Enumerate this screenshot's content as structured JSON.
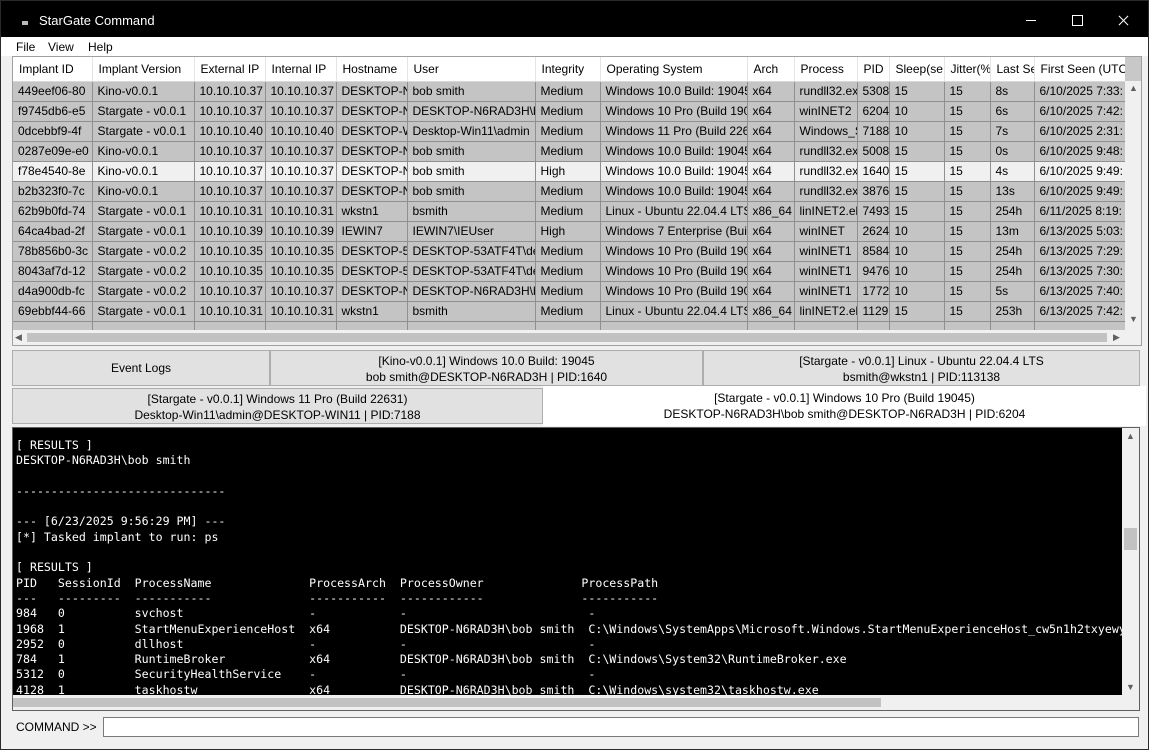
{
  "window": {
    "title": "StarGate Command"
  },
  "menu": [
    "File",
    "View",
    "Help"
  ],
  "grid": {
    "columns": [
      "Implant ID",
      "Implant Version",
      "External IP",
      "Internal IP",
      "Hostname",
      "User",
      "Integrity",
      "Operating System",
      "Arch",
      "Process",
      "PID",
      "Sleep(se",
      "Jitter(%",
      "Last Se",
      "First Seen (UTC)"
    ],
    "rows": [
      [
        "449eef06-80",
        "Kino-v0.0.1",
        "10.10.10.37",
        "10.10.10.37",
        "DESKTOP-N",
        "bob smith",
        "Medium",
        "Windows 10.0 Build: 19045",
        "x64",
        "rundll32.ex",
        "5308",
        "15",
        "15",
        "8s",
        "6/10/2025 7:33:"
      ],
      [
        "f9745db6-e5",
        "Stargate - v0.0.1",
        "10.10.10.37",
        "10.10.10.37",
        "DESKTOP-N",
        "DESKTOP-N6RAD3H\\bob",
        "Medium",
        "Windows 10 Pro (Build 190",
        "x64",
        "winINET2",
        "6204",
        "10",
        "15",
        "6s",
        "6/10/2025 7:42:"
      ],
      [
        "0dcebbf9-4f",
        "Stargate - v0.0.1",
        "10.10.10.40",
        "10.10.10.40",
        "DESKTOP-W",
        "Desktop-Win11\\admin",
        "Medium",
        "Windows 11 Pro (Build 226",
        "x64",
        "Windows_S",
        "7188",
        "10",
        "15",
        "7s",
        "6/10/2025 2:31:"
      ],
      [
        "0287e09e-e0",
        "Kino-v0.0.1",
        "10.10.10.37",
        "10.10.10.37",
        "DESKTOP-N",
        "bob smith",
        "Medium",
        "Windows 10.0 Build: 19045",
        "x64",
        "rundll32.ex",
        "5008",
        "15",
        "15",
        "0s",
        "6/10/2025 9:48:"
      ],
      [
        "f78e4540-8e",
        "Kino-v0.0.1",
        "10.10.10.37",
        "10.10.10.37",
        "DESKTOP-N",
        "bob smith",
        "High",
        "Windows 10.0 Build: 19045",
        "x64",
        "rundll32.ex",
        "1640",
        "15",
        "15",
        "4s",
        "6/10/2025 9:49:"
      ],
      [
        "b2b323f0-7c",
        "Kino-v0.0.1",
        "10.10.10.37",
        "10.10.10.37",
        "DESKTOP-N",
        "bob smith",
        "Medium",
        "Windows 10.0 Build: 19045",
        "x64",
        "rundll32.ex",
        "3876",
        "15",
        "15",
        "13s",
        "6/10/2025 9:49:"
      ],
      [
        "62b9b0fd-74",
        "Stargate - v0.0.1",
        "10.10.10.31",
        "10.10.10.31",
        "wkstn1",
        "bsmith",
        "Medium",
        "Linux - Ubuntu 22.04.4 LTS",
        "x86_64",
        "linINET2.elf",
        "7493",
        "15",
        "15",
        "254h",
        "6/11/2025 8:19:"
      ],
      [
        "64ca4bad-2f",
        "Stargate - v0.0.1",
        "10.10.10.39",
        "10.10.10.39",
        "IEWIN7",
        "IEWIN7\\IEUser",
        "High",
        "Windows 7 Enterprise (Bui",
        "x64",
        "winINET",
        "2624",
        "10",
        "15",
        "13m",
        "6/13/2025 5:03:"
      ],
      [
        "78b856b0-3c",
        "Stargate - v0.0.2",
        "10.10.10.35",
        "10.10.10.35",
        "DESKTOP-53",
        "DESKTOP-53ATF4T\\dev",
        "Medium",
        "Windows 10 Pro (Build 190",
        "x64",
        "winINET1",
        "8584",
        "10",
        "15",
        "254h",
        "6/13/2025 7:29:"
      ],
      [
        "8043af7d-12",
        "Stargate - v0.0.2",
        "10.10.10.35",
        "10.10.10.35",
        "DESKTOP-53",
        "DESKTOP-53ATF4T\\dev",
        "Medium",
        "Windows 10 Pro (Build 190",
        "x64",
        "winINET1",
        "9476",
        "10",
        "15",
        "254h",
        "6/13/2025 7:30:"
      ],
      [
        "d4a900db-fc",
        "Stargate - v0.0.2",
        "10.10.10.37",
        "10.10.10.37",
        "DESKTOP-N",
        "DESKTOP-N6RAD3H\\bob",
        "Medium",
        "Windows 10 Pro (Build 190",
        "x64",
        "winINET1",
        "1772",
        "10",
        "15",
        "5s",
        "6/13/2025 7:40:"
      ],
      [
        "69ebbf44-66",
        "Stargate - v0.0.1",
        "10.10.10.31",
        "10.10.10.31",
        "wkstn1",
        "bsmith",
        "Medium",
        "Linux - Ubuntu 22.04.4 LTS",
        "x86_64",
        "linINET2.elf",
        "1129",
        "15",
        "15",
        "253h",
        "6/13/2025 7:42:"
      ]
    ]
  },
  "tabs": {
    "event_logs": "Event Logs",
    "kino_line1": "[Kino-v0.0.1] Windows 10.0 Build: 19045",
    "kino_line2": "bob smith@DESKTOP-N6RAD3H | PID:1640",
    "linux_line1": "[Stargate - v0.0.1] Linux - Ubuntu 22.04.4 LTS",
    "linux_line2": "bsmith@wkstn1 | PID:113138",
    "win11_line1": "[Stargate - v0.0.1] Windows 11 Pro (Build 22631)",
    "win11_line2": "Desktop-Win11\\admin@DESKTOP-WIN11 | PID:7188",
    "active_line1": "[Stargate - v0.0.1] Windows 10 Pro (Build 19045)",
    "active_line2": "DESKTOP-N6RAD3H\\bob smith@DESKTOP-N6RAD3H | PID:6204"
  },
  "console": {
    "lines": [
      "[ RESULTS ]",
      "DESKTOP-N6RAD3H\\bob smith",
      "",
      "------------------------------",
      "",
      "--- [6/23/2025 9:56:29 PM] ---",
      "[*] Tasked implant to run: ps",
      "",
      "[ RESULTS ]",
      "PID   SessionId  ProcessName              ProcessArch  ProcessOwner              ProcessPath",
      "---   ---------  -----------              -----------  ------------              -----------",
      "984   0          svchost                  -            -                          -",
      "1968  1          StartMenuExperienceHost  x64          DESKTOP-N6RAD3H\\bob smith  C:\\Windows\\SystemApps\\Microsoft.Windows.StartMenuExperienceHost_cw5n1h2txyewy\\StartMenuExperienceHost.exe",
      "2952  0          dllhost                  -            -                          -",
      "784   1          RuntimeBroker            x64          DESKTOP-N6RAD3H\\bob smith  C:\\Windows\\System32\\RuntimeBroker.exe",
      "5312  0          SecurityHealthService    -            -                          -",
      "4128  1          taskhostw                x64          DESKTOP-N6RAD3H\\bob smith  C:\\Windows\\system32\\taskhostw.exe"
    ]
  },
  "command": {
    "label": "COMMAND >>",
    "value": ""
  }
}
